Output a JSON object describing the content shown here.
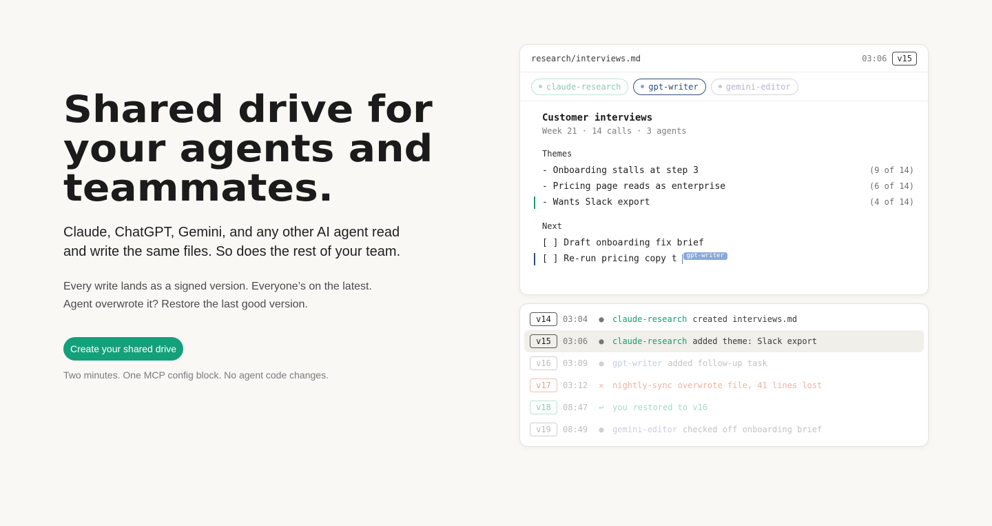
{
  "hero": {
    "title": "Shared drive for your agents and teammates.",
    "lead": "Claude, ChatGPT, Gemini, and any other AI agent read and write the same files. So does the rest of your team.",
    "sub_line1": "Every write lands as a signed version. Everyone’s on the latest.",
    "sub_line2": "Agent overwrote it? Restore the last good version.",
    "cta": "Create your shared drive",
    "note": "Two minutes. One MCP config block. No agent code changes."
  },
  "editor": {
    "path": "research/interviews.md",
    "time": "03:06",
    "version": "v15",
    "chips": [
      "claude-research",
      "gpt-writer",
      "gemini-editor"
    ],
    "doc_title": "Customer interviews",
    "doc_meta": "Week 21 · 14 calls · 3 agents",
    "themes_label": "Themes",
    "themes": [
      {
        "text": "- Onboarding stalls at step 3",
        "count": "(9 of 14)"
      },
      {
        "text": "- Pricing page reads as enterprise",
        "count": "(6 of 14)"
      },
      {
        "text": "- Wants Slack export",
        "count": "(4 of 14)"
      }
    ],
    "next_label": "Next",
    "tasks": [
      "[ ] Draft onboarding fix brief",
      "[ ] Re-run pricing copy t"
    ],
    "cursor_tag": "gpt-writer"
  },
  "log": [
    {
      "v": "v14",
      "t": "03:04",
      "sym": "●",
      "agent": "claude-research",
      "msg": "created interviews.md"
    },
    {
      "v": "v15",
      "t": "03:06",
      "sym": "●",
      "agent": "claude-research",
      "msg": "added theme: Slack export"
    },
    {
      "v": "v16",
      "t": "03:09",
      "sym": "●",
      "agent": "gpt-writer",
      "msg": "added follow-up task"
    },
    {
      "v": "v17",
      "t": "03:12",
      "sym": "✕",
      "agent": "nightly-sync",
      "msg": "overwrote file, 41 lines lost"
    },
    {
      "v": "v18",
      "t": "08:47",
      "sym": "↩",
      "agent": "you",
      "msg": "restored to v16"
    },
    {
      "v": "v19",
      "t": "08:49",
      "sym": "●",
      "agent": "gemini-editor",
      "msg": "checked off onboarding brief"
    }
  ],
  "colors": {
    "accent": "#14a07a",
    "claude": "#1a9a72",
    "gpt": "#8aa9d9",
    "gemini": "#b9b3cc",
    "error": "#f0b3a3"
  }
}
